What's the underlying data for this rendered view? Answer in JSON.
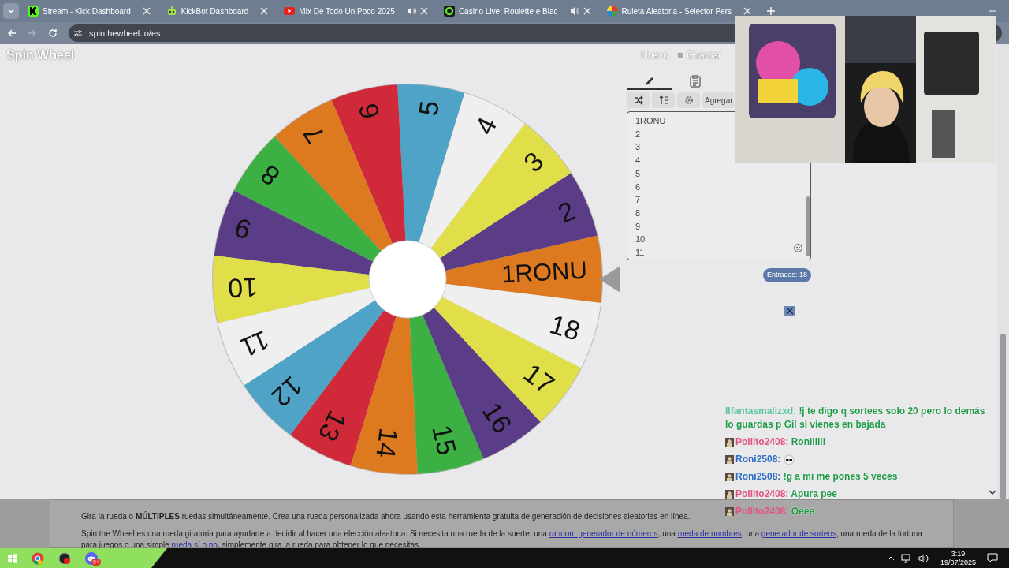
{
  "browser": {
    "tabs": [
      {
        "title": "Stream - Kick Dashboard",
        "audio": false
      },
      {
        "title": "KickBot Dashboard",
        "audio": false
      },
      {
        "title": "Mix De Todo Un Poco 2025",
        "audio": true
      },
      {
        "title": "Casino Live: Roulette e Blac",
        "audio": true
      },
      {
        "title": "Ruleta Aleatoria - Selector Pers",
        "audio": false
      }
    ],
    "url": "spinthewheel.io/es"
  },
  "header": {
    "logo": "Spin Wheel",
    "actions": [
      "Nuevo",
      "Guardar"
    ]
  },
  "wheel": {
    "segments": [
      {
        "label": "1RONU",
        "color": "#dd7a1f"
      },
      {
        "label": "2",
        "color": "#5b3c86"
      },
      {
        "label": "3",
        "color": "#e0df4a"
      },
      {
        "label": "4",
        "color": "#efefef"
      },
      {
        "label": "5",
        "color": "#4fa3c7"
      },
      {
        "label": "6",
        "color": "#d02a3a"
      },
      {
        "label": "7",
        "color": "#dd7a1f"
      },
      {
        "label": "8",
        "color": "#3cb043"
      },
      {
        "label": "9",
        "color": "#5b3c86"
      },
      {
        "label": "10",
        "color": "#e0df4a"
      },
      {
        "label": "11",
        "color": "#efefef"
      },
      {
        "label": "12",
        "color": "#4fa3c7"
      },
      {
        "label": "13",
        "color": "#d02a3a"
      },
      {
        "label": "14",
        "color": "#dd7a1f"
      },
      {
        "label": "15",
        "color": "#3cb043"
      },
      {
        "label": "16",
        "color": "#5b3c86"
      },
      {
        "label": "17",
        "color": "#e0df4a"
      },
      {
        "label": "18",
        "color": "#efefef"
      }
    ]
  },
  "editor": {
    "tabs": [
      {
        "selected": true
      },
      {
        "selected": false
      }
    ],
    "add_button": "Agregar",
    "entries": [
      "1RONU",
      "2",
      "3",
      "4",
      "5",
      "6",
      "7",
      "8",
      "9",
      "10",
      "11"
    ],
    "count": "Entradas: 18"
  },
  "chat": {
    "messages": [
      {
        "user": "Ilfantasmalizxd:",
        "color": "#5cc79a",
        "avatar": false,
        "text": "!j te digo q sortees solo 20 pero lo demás lo guardas p Gil si vienes en bajada"
      },
      {
        "user": "Pollito2408:",
        "color": "#e0557e",
        "avatar": true,
        "text": "Roniiiiii"
      },
      {
        "user": "Roni2508:",
        "color": "#2f6fc4",
        "avatar": true,
        "kind": "emote"
      },
      {
        "user": "Roni2508:",
        "color": "#2f6fc4",
        "avatar": true,
        "text": "!g a mi me pones 5 veces"
      },
      {
        "user": "Pollito2408:",
        "color": "#e0557e",
        "avatar": true,
        "text": "Apura pee"
      },
      {
        "user": "Pollito2408:",
        "color": "#e0557e",
        "avatar": true,
        "text": "Oeee"
      }
    ]
  },
  "description": {
    "paragraphs": [
      [
        {
          "kind": "text",
          "text": "Gira la rueda o **MÚLTIPLES** ruedas simultáneamente. Crea una rueda personalizada ahora usando esta herramienta gratuita de generación de decisiones aleatorias en línea."
        }
      ],
      [
        {
          "kind": "text",
          "text": "Spin the Wheel es una rueda giratoria para ayudarte a decidir al hacer una elección aleatoria. Si necesita una rueda de la suerte, una "
        },
        {
          "kind": "link",
          "text": "random generador de números"
        },
        {
          "kind": "text",
          "text": ", una "
        },
        {
          "kind": "link",
          "text": "rueda de nombres"
        },
        {
          "kind": "text",
          "text": ", una "
        },
        {
          "kind": "link",
          "text": "generador de sorteos"
        },
        {
          "kind": "text",
          "text": ", una rueda de la fortuna para juegos o una simple "
        },
        {
          "kind": "link",
          "text": "rueda sí o no"
        },
        {
          "kind": "text",
          "text": ", simplemente gira la rueda para obtener lo que necesitas."
        }
      ]
    ]
  },
  "taskbar": {
    "discord_badge": "9+",
    "time": "3:19",
    "date": "19/07/2025"
  }
}
